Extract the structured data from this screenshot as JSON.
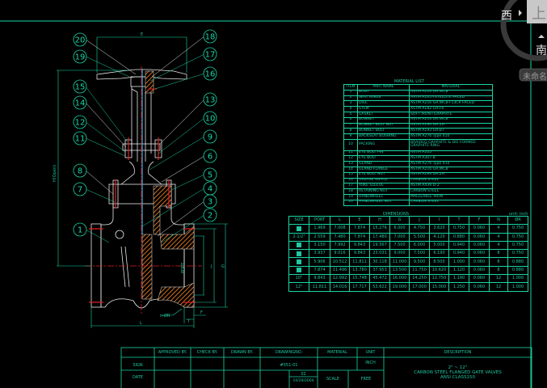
{
  "material_list": {
    "title": "MATERIAL LIST",
    "headers": [
      "ITEM",
      "PART NAME",
      "MATERIAL"
    ],
    "rows": [
      [
        "1",
        "BODY",
        "ASTM A216 GR.WCB"
      ],
      [
        "2",
        "SEAT RINGS",
        "ASTM A105+STELLITE FACED"
      ],
      [
        "3",
        "DISC",
        "ASTM A216 GR.WCB+13CR FACED"
      ],
      [
        "4",
        "STEM",
        "ASTM A182 GR.F6"
      ],
      [
        "5",
        "GASKET",
        "SOFT IRON+GRAPHITE"
      ],
      [
        "6",
        "BONNET",
        "ASTM A216 GR.WCB"
      ],
      [
        "7",
        "BONNET BOLT NUT",
        "ASTM A194 GR.2H"
      ],
      [
        "8",
        "BONNET BOLT",
        "ASTM A193 GR.B7"
      ],
      [
        "9",
        "BACKSEAT BUSHING",
        "ASTM A276 Type 410"
      ],
      [
        "10",
        "PACKING",
        "BRAIDED GRAPHITE & DIE FORMED GRAPHITE RING"
      ],
      [
        "11",
        "EYE BOLT PIN",
        "ASTM A105"
      ],
      [
        "12",
        "EYE BOLT",
        "ASTM A307 B"
      ],
      [
        "13",
        "GLAND",
        "ASTM A276 Type 410"
      ],
      [
        "14",
        "GLAND FLANGE",
        "ASTM A216 GR.WCB"
      ],
      [
        "15",
        "EYE BOLT NUT",
        "ASTM A194 GR.2H"
      ],
      [
        "16",
        "GREASE NIPPLE",
        "CARBON STEEL"
      ],
      [
        "17",
        "YOKE SLEEVE",
        "ASTM A439 D-2"
      ],
      [
        "18",
        "RETAINING NUT",
        "CARBON STEEL"
      ],
      [
        "19",
        "HANDWHEEL",
        "MALLEABLE IRON"
      ],
      [
        "20",
        "HANDWHEEL NUT",
        "CARBON STEEL"
      ]
    ]
  },
  "dimensions": {
    "title": "DIMENSIONS",
    "unit": "unit: inch",
    "headers": [
      "SIZE",
      "PORT",
      "L",
      "E",
      "H",
      "G",
      "J",
      "I",
      "T",
      "F",
      "N",
      "ØR"
    ],
    "rows": [
      [
        "■",
        "1.969",
        "7.008",
        "7.874",
        "15.276",
        "6.000",
        "4.750",
        "3.620",
        "0.750",
        "0.060",
        "4",
        "0.750"
      ],
      [
        "2-1/2\"",
        "2.559",
        "7.480",
        "7.874",
        "17.480",
        "7.000",
        "5.500",
        "4.120",
        "0.880",
        "0.060",
        "4",
        "0.750"
      ],
      [
        "■",
        "3.150",
        "7.992",
        "9.843",
        "19.567",
        "7.500",
        "6.000",
        "5.000",
        "0.940",
        "0.060",
        "4",
        "0.750"
      ],
      [
        "■",
        "3.937",
        "9.016",
        "9.843",
        "23.031",
        "9.000",
        "7.500",
        "6.190",
        "0.940",
        "0.060",
        "8",
        "0.750"
      ],
      [
        "■",
        "5.906",
        "10.512",
        "11.811",
        "30.118",
        "11.000",
        "9.500",
        "8.500",
        "1.000",
        "0.060",
        "8",
        "0.880"
      ],
      [
        "■",
        "7.874",
        "11.496",
        "13.780",
        "37.953",
        "13.500",
        "11.750",
        "10.620",
        "1.120",
        "0.060",
        "8",
        "0.880"
      ],
      [
        "10\"",
        "9.843",
        "12.992",
        "15.748",
        "45.472",
        "16.000",
        "14.250",
        "12.750",
        "1.190",
        "0.060",
        "12",
        "1.000"
      ],
      [
        "12\"",
        "11.811",
        "14.016",
        "17.717",
        "53.622",
        "19.000",
        "17.000",
        "15.000",
        "1.250",
        "0.060",
        "12",
        "1.000"
      ]
    ]
  },
  "title_block": {
    "approved_by": "APPROVED BY.",
    "check_by": "CHECK BY.",
    "drawn_by": "DRAWN BY.",
    "drawing_no_label": "DRAWINGNO.",
    "material_label": "MATERIAL",
    "unit_label": "UNIT",
    "description_label": "DESCRIPTION",
    "sign_label": "SIGN",
    "date_label": "DATE",
    "drawing_no": "#551-01",
    "unit": "INCH",
    "revision": "02",
    "date": "10/29/2004",
    "scale_label": "SCALE",
    "scale": "FREE",
    "desc_line1": "2\" ~ 12\"",
    "desc_line2": "CARBON STEEL FLANGED GATE VALVES",
    "desc_line3": "ANSI CLASS150"
  },
  "drawing": {
    "dim_e": "E",
    "dim_h": "H(Open)",
    "dim_l": "L",
    "dim_port": "PORT",
    "dim_j": "J",
    "dim_g": "G",
    "dim_f": "F",
    "dim_t": "T",
    "dim_nr": "n-ØR",
    "balloons": [
      "20",
      "19",
      "15",
      "14",
      "12",
      "11",
      "8",
      "7",
      "1",
      "18",
      "17",
      "16",
      "13",
      "10",
      "9",
      "6",
      "5",
      "4",
      "3",
      "2"
    ]
  },
  "viewcube": {
    "west": "西",
    "top": "上",
    "south": "南",
    "view_name": "未命名"
  },
  "colors": {
    "line": "#19d6a6",
    "text": "#1ec8a0",
    "hatch": "#d07020",
    "center": "#e02020",
    "part": "#e8e8e8"
  }
}
